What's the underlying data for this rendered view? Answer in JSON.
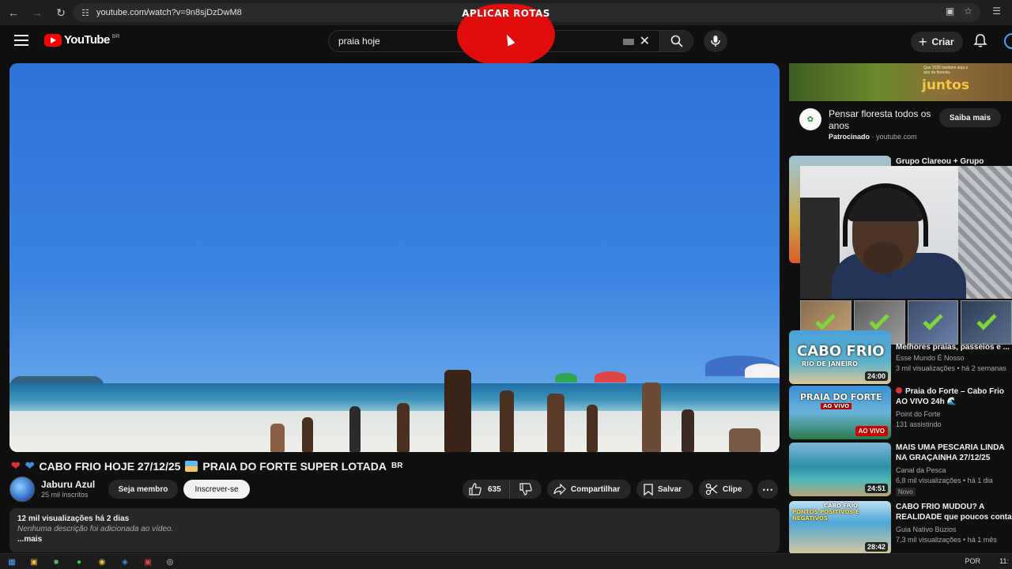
{
  "browser": {
    "url": "youtube.com/watch?v=9n8sjDzDwM8",
    "back_icon": "arrow-left-icon",
    "forward_icon": "arrow-right-icon",
    "reload_icon": "reload-icon"
  },
  "header": {
    "logo_text": "YouTube",
    "region": "BR",
    "search_query": "praia hoje",
    "create_label": "Criar"
  },
  "overlay": {
    "badge_text": "APLICAR ROTAS"
  },
  "video": {
    "title": "CABO FRIO HOJE 27/12/25",
    "title_part2": "PRAIA DO FORTE SUPER LOTADA",
    "title_suffix": "BR",
    "channel_name": "Jaburu Azul",
    "subscribers": "25 mil inscritos",
    "member_label": "Seja membro",
    "subscribe_label": "Inscrever-se",
    "likes": "635",
    "share_label": "Compartilhar",
    "save_label": "Salvar",
    "clip_label": "Clipe",
    "more_label": "...",
    "stats": "12 mil visualizações  há 2 dias",
    "description": "Nenhuma descrição foi adicionada ao vídeo.",
    "more_link": "...mais"
  },
  "ad": {
    "banner_small": "Que 2026 também seja o ano da floresta.",
    "banner_big": "juntos",
    "title": "Pensar floresta todos os anos",
    "sponsored": "Patrocinado",
    "domain": "· youtube.com",
    "cta": "Saiba mais"
  },
  "recommendations": [
    {
      "title": "Grupo Clareou + Grupo",
      "channel": "",
      "meta": ""
    },
    {
      "title": "Melhores praias, passeios e ...",
      "channel": "Esse Mundo É Nosso",
      "meta": "3 mil visualizações • há 2 semanas",
      "duration": "24:00",
      "thumb_title": "CABO FRIO",
      "thumb_sub": "RIO DE JANEIRO"
    },
    {
      "title": "Praia do Forte – Cabo Frio",
      "title_line2": "AO VIVO 24h 🌊",
      "channel": "Point do Forte",
      "meta": "131 assistindo",
      "live_label": "AO VIVO",
      "thumb_title": "PRAIA DO FORTE",
      "thumb_sub": "AO VIVO"
    },
    {
      "title": "MAIS UMA PESCARIA LINDA",
      "title_line2": "NA GRAÇAINHA 27/12/25",
      "channel": "Canal da Pesca",
      "meta": "6,8 mil visualizações • há 1 dia",
      "badge": "Novo",
      "duration": "24:51"
    },
    {
      "title": "CABO FRIO MUDOU? A",
      "title_line2": "REALIDADE que poucos contam",
      "channel": "Guia Nativo Búzios",
      "meta": "7,3 mil visualizações • há 1 mês",
      "duration": "28:42",
      "thumb_title": "CABO FRIO",
      "thumb_sub": "PONTOS POSITIVOS E NEGATIVOS"
    }
  ],
  "taskbar": {
    "language": "POR",
    "time": "11:"
  },
  "colors": {
    "background": "#0f0f0f",
    "accent_red": "#ff0000",
    "badge_red": "#e10c0c",
    "pill_bg": "#272727"
  }
}
